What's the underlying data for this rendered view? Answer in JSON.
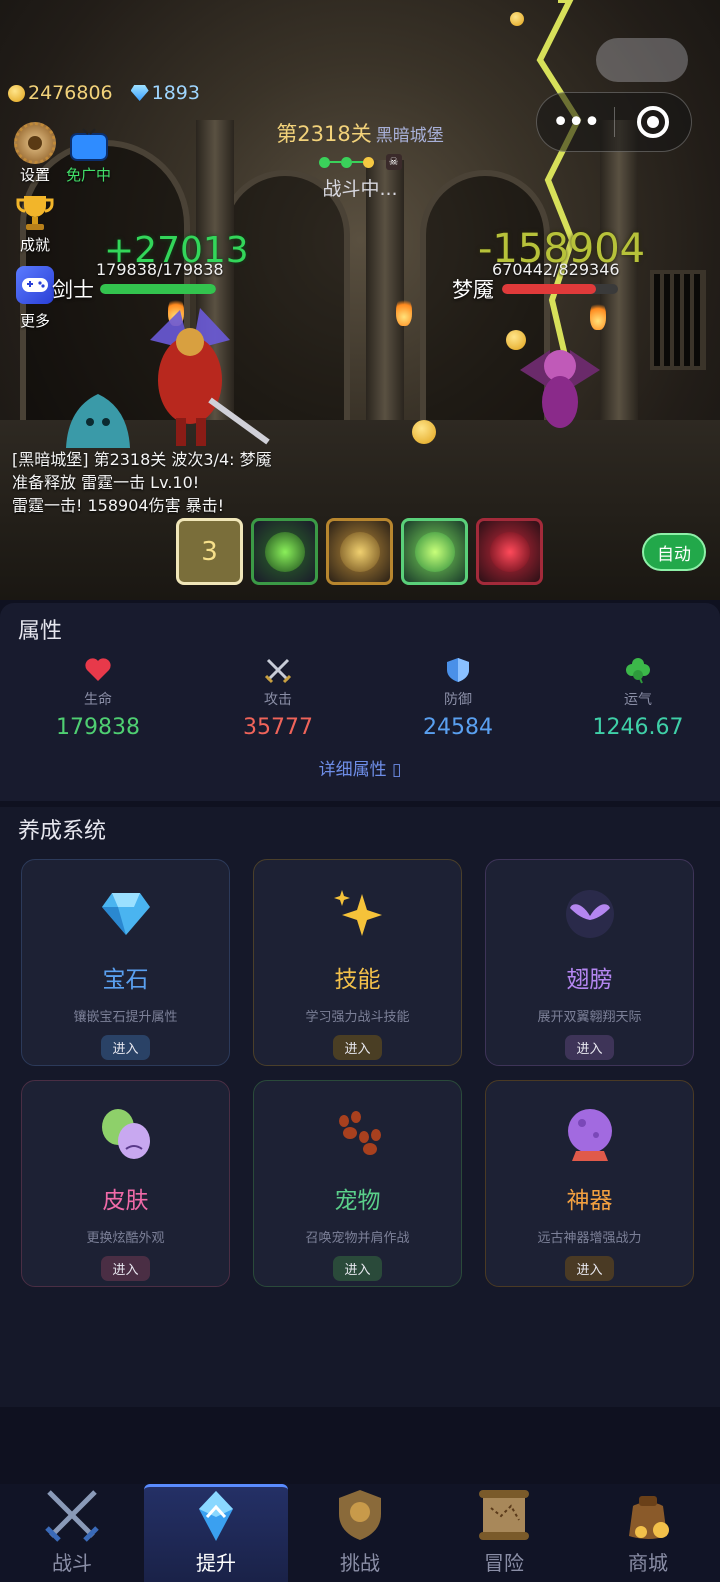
{
  "resources": {
    "gold": "2476806",
    "gems": "1893"
  },
  "side_menu": {
    "settings": "设置",
    "ad_free": "免广中",
    "achievements": "成就",
    "more": "更多"
  },
  "stage": {
    "number": "第2318关",
    "name": "黑暗城堡",
    "status": "战斗中..."
  },
  "player": {
    "name": "剑士",
    "hp_text": "179838/179838",
    "hp_ratio": 1.0,
    "heal_popup": "+27013"
  },
  "enemy": {
    "name": "梦魇",
    "hp_text": "670442/829346",
    "hp_ratio": 0.808,
    "damage_popup": "-158904"
  },
  "battle_log": [
    "[黑暗城堡] 第2318关 波次3/4: 梦魇",
    "准备释放 雷霆一击 Lv.10!",
    "雷霆一击! 158904伤害 暴击!"
  ],
  "skills": {
    "cooldown": "3"
  },
  "auto_button": "自动",
  "attributes": {
    "title": "属性",
    "items": [
      {
        "label": "生命",
        "value": "179838",
        "color": "#4fcf72",
        "icon": "heart-icon"
      },
      {
        "label": "攻击",
        "value": "35777",
        "color": "#f0645a",
        "icon": "crossed-swords-icon"
      },
      {
        "label": "防御",
        "value": "24584",
        "color": "#5aa0f0",
        "icon": "shield-icon"
      },
      {
        "label": "运气",
        "value": "1246.67",
        "color": "#3fd0a8",
        "icon": "clover-icon"
      }
    ],
    "detail_link": "详细属性 ▯"
  },
  "growth": {
    "title": "养成系统",
    "cards": [
      {
        "name": "宝石",
        "desc": "镶嵌宝石提升属性",
        "enter": "进入",
        "color": "#5aa0f0",
        "icon": "gem-icon"
      },
      {
        "name": "技能",
        "desc": "学习强力战斗技能",
        "enter": "进入",
        "color": "#f2c04a",
        "icon": "sparkles-icon"
      },
      {
        "name": "翅膀",
        "desc": "展开双翼翱翔天际",
        "enter": "进入",
        "color": "#b486f0",
        "icon": "wings-icon"
      },
      {
        "name": "皮肤",
        "desc": "更换炫酷外观",
        "enter": "进入",
        "color": "#f06aa8",
        "icon": "masks-icon"
      },
      {
        "name": "宠物",
        "desc": "召唤宠物并肩作战",
        "enter": "进入",
        "color": "#5ad08a",
        "icon": "paw-icon"
      },
      {
        "name": "神器",
        "desc": "远古神器增强战力",
        "enter": "进入",
        "color": "#f2a040",
        "icon": "crystal-ball-icon"
      }
    ]
  },
  "bottom_nav": [
    {
      "label": "战斗",
      "icon": "swords-icon"
    },
    {
      "label": "提升",
      "icon": "upgrade-crystal-icon",
      "active": true
    },
    {
      "label": "挑战",
      "icon": "trophy-shield-icon"
    },
    {
      "label": "冒险",
      "icon": "map-scroll-icon"
    },
    {
      "label": "商城",
      "icon": "treasure-bag-icon"
    }
  ]
}
